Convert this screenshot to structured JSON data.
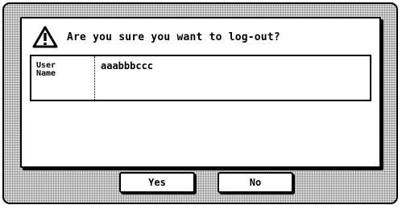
{
  "dialog": {
    "icon": "warning-triangle-icon",
    "message": "Are you sure you want to log-out?",
    "field_label": "User Name",
    "field_value": "aaabbbccc"
  },
  "buttons": {
    "yes_label": "Yes",
    "no_label": "No"
  }
}
